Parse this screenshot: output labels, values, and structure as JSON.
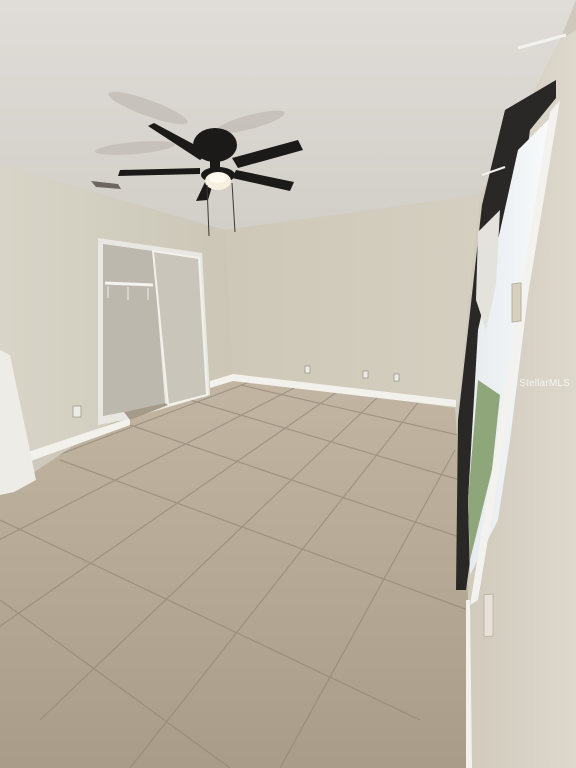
{
  "watermark": {
    "text": "StellarMLS"
  },
  "colors": {
    "ceiling": "#d9d6d1",
    "wall_back": "#cfcab9",
    "wall_left": "#d3cfc0",
    "wall_right": "#d8d3c6",
    "floor": "#b7aa97",
    "grout": "#8f8575",
    "baseboard": "#f2f1ec",
    "fan": "#1c1a19",
    "door_frame": "#e9e7e2",
    "window_light": "#f1f4f6"
  },
  "icons": {
    "ceiling_fan": "ceiling-fan-icon",
    "light": "light-bulb-icon",
    "vent": "air-vent-icon",
    "outlet": "outlet-icon",
    "switch": "light-switch-icon"
  }
}
